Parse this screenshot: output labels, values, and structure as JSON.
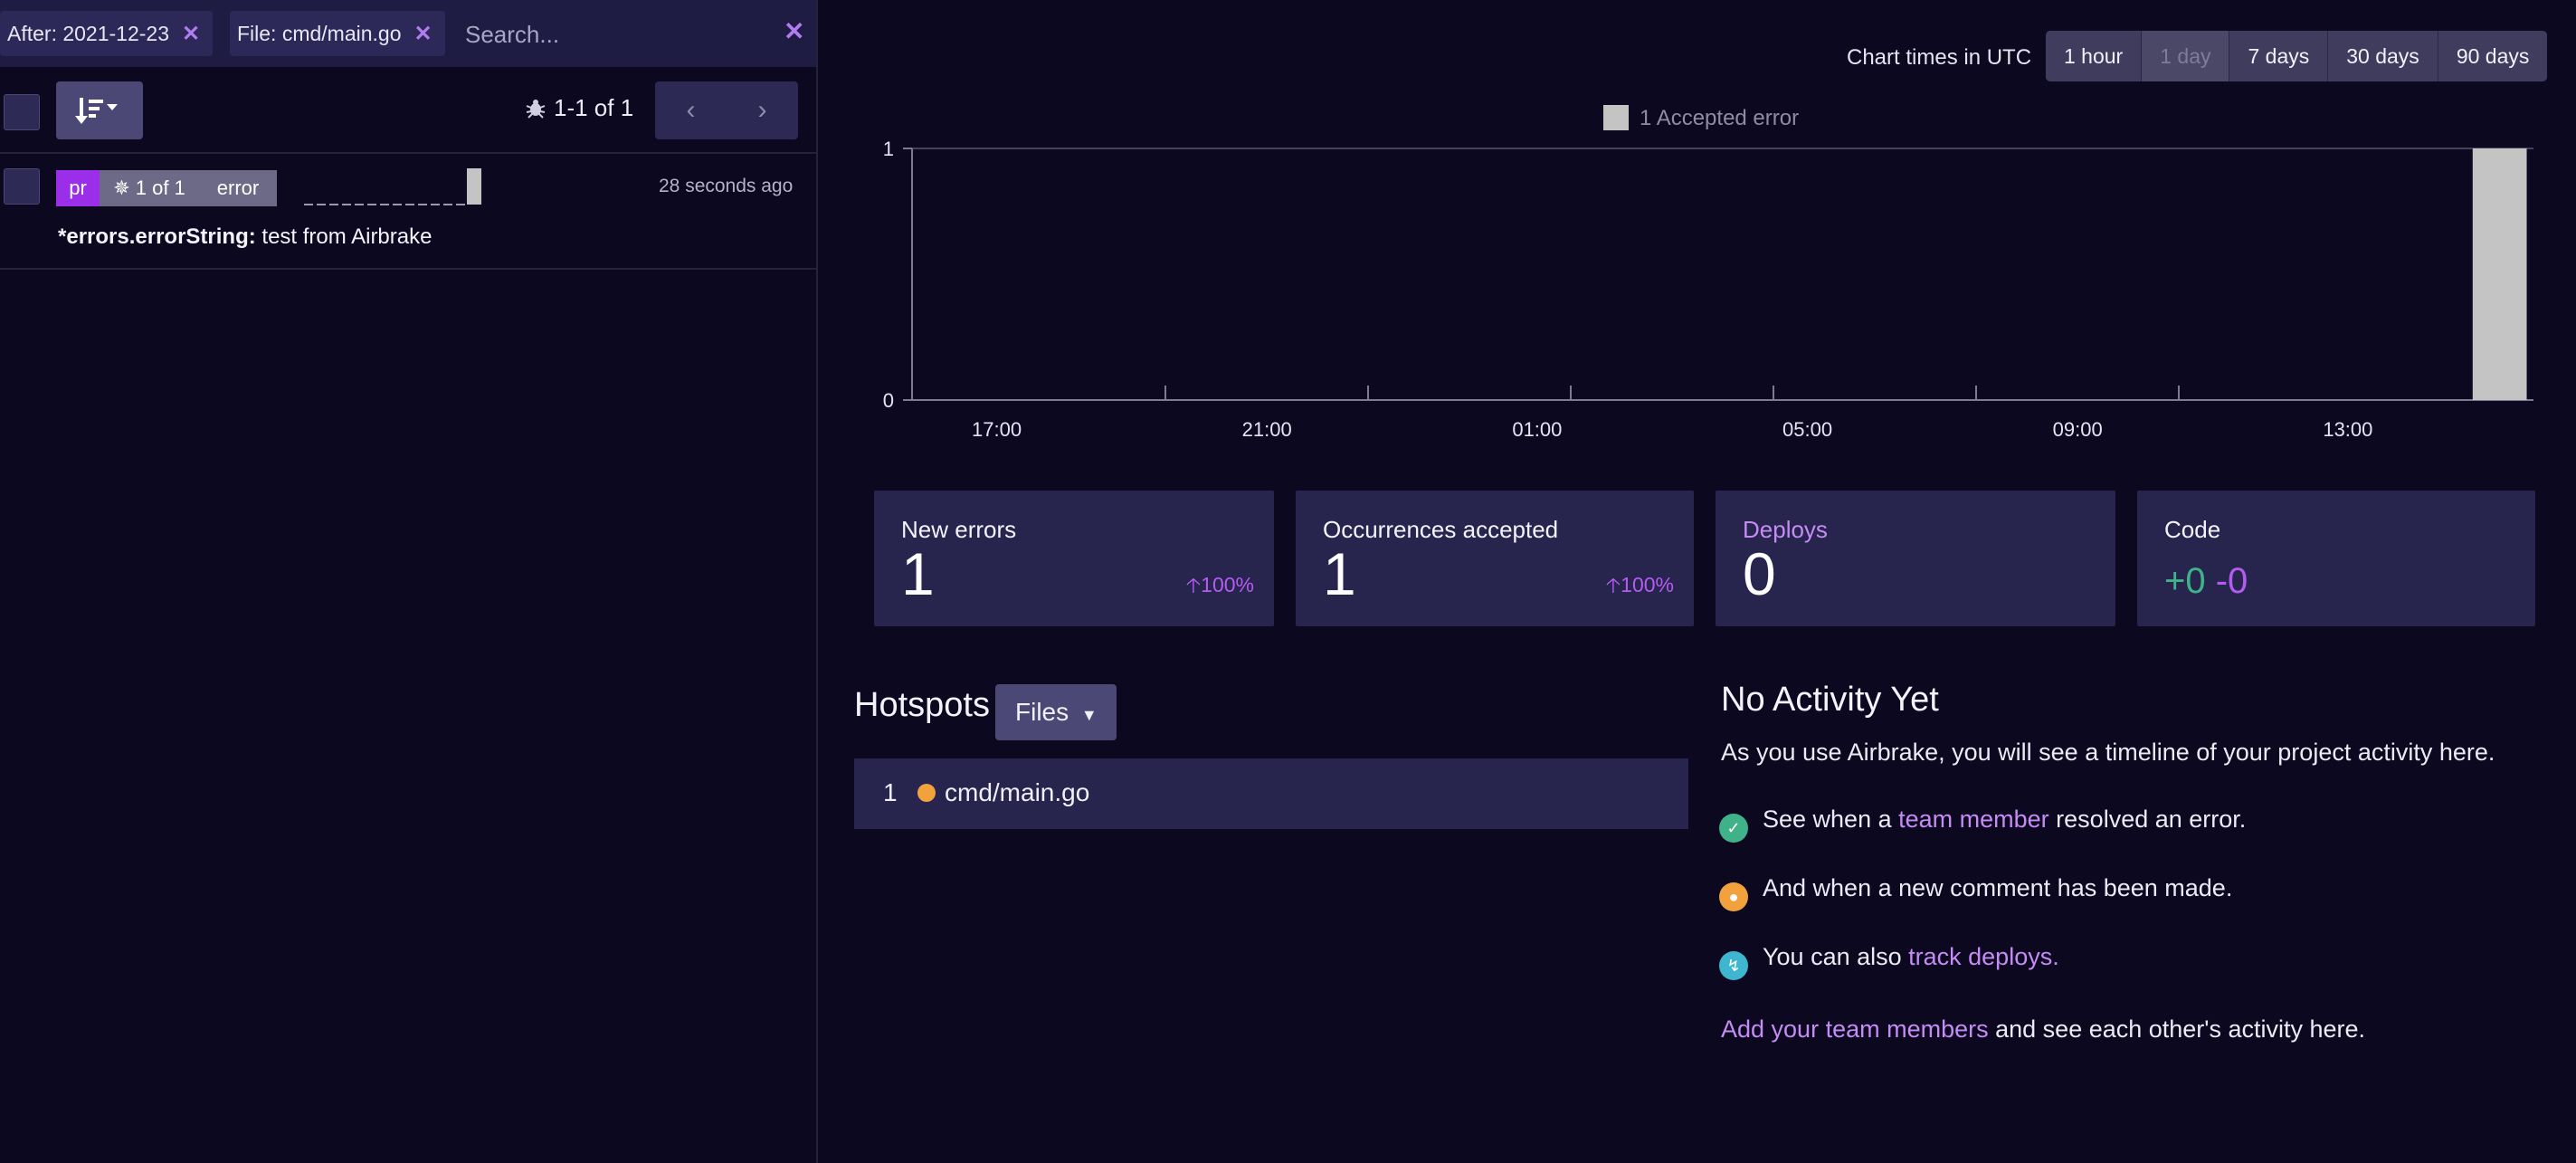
{
  "filters": {
    "chips": [
      {
        "label": "After: 2021-12-23"
      },
      {
        "label": "File: cmd/main.go"
      }
    ],
    "search_placeholder": "Search...",
    "clear_icon": "close-icon"
  },
  "list_toolbar": {
    "pagination": "1-1 of 1",
    "prev_icon": "chevron-left-icon",
    "next_icon": "chevron-right-icon"
  },
  "notice": {
    "env_badge": "pr",
    "occurrence_badge": "1 of 1",
    "severity_badge": "error",
    "time_ago": "28 seconds ago",
    "message_prefix": "*errors.errorString:",
    "message_text": " test from Airbrake",
    "sparkline_fraction": 0.08,
    "badge_colors": {
      "env": "#9b2ee8",
      "occurrence": "#6c6a86",
      "severity": "#6c6a86"
    }
  },
  "chart_header": {
    "timezone_label": "Chart times in UTC",
    "ranges": [
      {
        "label": "1 hour",
        "disabled": false
      },
      {
        "label": "1 day",
        "disabled": true
      },
      {
        "label": "7 days",
        "disabled": false
      },
      {
        "label": "30 days",
        "disabled": false
      },
      {
        "label": "90 days",
        "disabled": false
      }
    ]
  },
  "chart_data": {
    "type": "bar",
    "series": [
      {
        "name": "1 Accepted error",
        "color": "#c4c4c4",
        "values": [
          {
            "x": "15:45",
            "y": 1
          }
        ]
      }
    ],
    "x_tick_labels": [
      "17:00",
      "21:00",
      "01:00",
      "05:00",
      "09:00",
      "13:00"
    ],
    "y_tick_labels": [
      "0",
      "1"
    ],
    "ylim": [
      0,
      1
    ],
    "x_start_hour": 16.25,
    "x_span_hours": 24,
    "grid": false,
    "legend": "top-center"
  },
  "stats": [
    {
      "title": "New errors",
      "value": "1",
      "change": "100%",
      "title_color": "#f4f3fb"
    },
    {
      "title": "Occurrences accepted",
      "value": "1",
      "change": "100%",
      "title_color": "#f4f3fb"
    },
    {
      "title": "Deploys",
      "value": "0",
      "change": "",
      "title_color": "#c48cf4"
    },
    {
      "title": "Code",
      "value": "",
      "change": "",
      "title_color": "#f4f3fb",
      "additions": "+0",
      "deletions": "-0"
    }
  ],
  "hotspots": {
    "title": "Hotspots",
    "filter_button": "Files",
    "rows": [
      {
        "rank": "1",
        "file": "cmd/main.go",
        "dot_color": "#f2a23d"
      }
    ]
  },
  "activity": {
    "title": "No Activity Yet",
    "subtitle": "As you use Airbrake, you will see a timeline of your project activity here.",
    "row1_prefix": "See when a ",
    "row1_link": "team member",
    "row1_suffix": " resolved an error.",
    "row2_text": "And when a new comment has been made.",
    "row3_prefix": "You can also ",
    "row3_link": "track deploys.",
    "footer_link": "Add your team members",
    "footer_suffix": " and see each other's activity here.",
    "icon_colors": {
      "resolved": "#3fb28a",
      "comment": "#f2a23d",
      "deploy": "#3fb6d0"
    }
  }
}
